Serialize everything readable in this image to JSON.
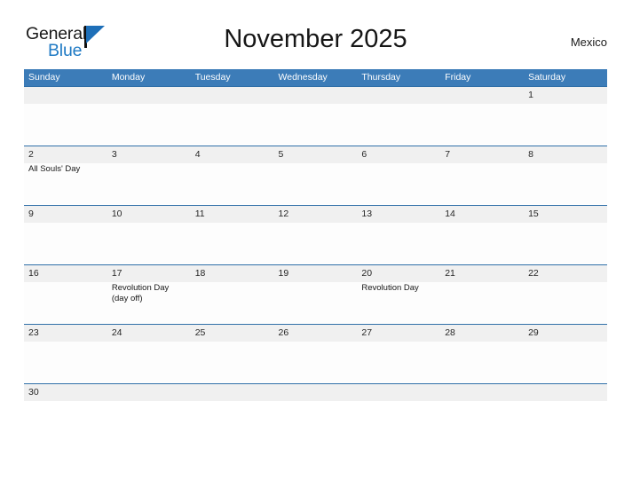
{
  "brand": {
    "name_part1": "General",
    "name_part2": "Blue",
    "flag_icon": "blue-flag-triangle-icon",
    "color_dark": "#1a1a1a",
    "color_blue": "#1f7ac4"
  },
  "header": {
    "title": "November 2025",
    "country": "Mexico"
  },
  "theme": {
    "header_blue": "#3c7cb8",
    "row_border_blue": "#2f6fa8",
    "daynum_strip_gray": "#f0f0f0",
    "body_white": "#fdfdfd"
  },
  "calendar": {
    "weekday_headers": [
      "Sunday",
      "Monday",
      "Tuesday",
      "Wednesday",
      "Thursday",
      "Friday",
      "Saturday"
    ],
    "weeks": [
      {
        "partial": false,
        "days": [
          {
            "number": "",
            "events": []
          },
          {
            "number": "",
            "events": []
          },
          {
            "number": "",
            "events": []
          },
          {
            "number": "",
            "events": []
          },
          {
            "number": "",
            "events": []
          },
          {
            "number": "",
            "events": []
          },
          {
            "number": "1",
            "events": []
          }
        ]
      },
      {
        "partial": false,
        "days": [
          {
            "number": "2",
            "events": [
              "All Souls' Day"
            ]
          },
          {
            "number": "3",
            "events": []
          },
          {
            "number": "4",
            "events": []
          },
          {
            "number": "5",
            "events": []
          },
          {
            "number": "6",
            "events": []
          },
          {
            "number": "7",
            "events": []
          },
          {
            "number": "8",
            "events": []
          }
        ]
      },
      {
        "partial": false,
        "days": [
          {
            "number": "9",
            "events": []
          },
          {
            "number": "10",
            "events": []
          },
          {
            "number": "11",
            "events": []
          },
          {
            "number": "12",
            "events": []
          },
          {
            "number": "13",
            "events": []
          },
          {
            "number": "14",
            "events": []
          },
          {
            "number": "15",
            "events": []
          }
        ]
      },
      {
        "partial": false,
        "days": [
          {
            "number": "16",
            "events": []
          },
          {
            "number": "17",
            "events": [
              "Revolution Day",
              "(day off)"
            ]
          },
          {
            "number": "18",
            "events": []
          },
          {
            "number": "19",
            "events": []
          },
          {
            "number": "20",
            "events": [
              "Revolution Day"
            ]
          },
          {
            "number": "21",
            "events": []
          },
          {
            "number": "22",
            "events": []
          }
        ]
      },
      {
        "partial": false,
        "days": [
          {
            "number": "23",
            "events": []
          },
          {
            "number": "24",
            "events": []
          },
          {
            "number": "25",
            "events": []
          },
          {
            "number": "26",
            "events": []
          },
          {
            "number": "27",
            "events": []
          },
          {
            "number": "28",
            "events": []
          },
          {
            "number": "29",
            "events": []
          }
        ]
      },
      {
        "partial": true,
        "days": [
          {
            "number": "30",
            "events": []
          },
          {
            "number": "",
            "events": []
          },
          {
            "number": "",
            "events": []
          },
          {
            "number": "",
            "events": []
          },
          {
            "number": "",
            "events": []
          },
          {
            "number": "",
            "events": []
          },
          {
            "number": "",
            "events": []
          }
        ]
      }
    ]
  }
}
